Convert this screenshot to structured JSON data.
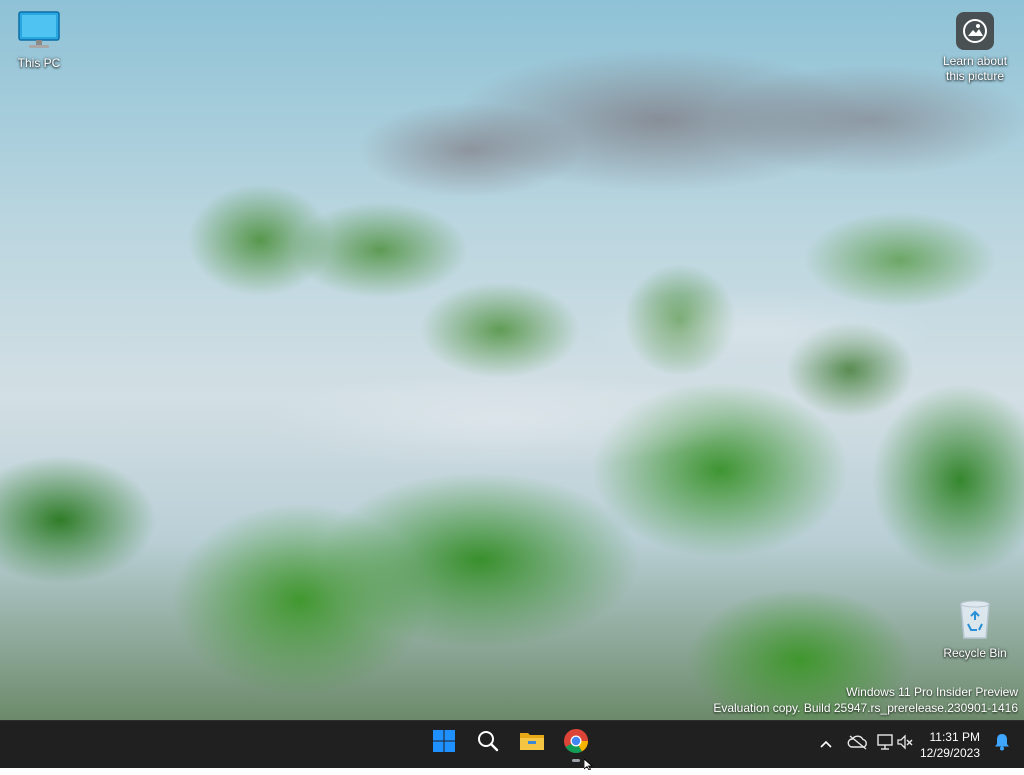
{
  "desktop": {
    "icons": {
      "this_pc": "This PC",
      "learn_line1": "Learn about",
      "learn_line2": "this picture",
      "recycle_bin": "Recycle Bin"
    },
    "watermark": {
      "line1": "Windows 11 Pro Insider Preview",
      "line2": "Evaluation copy. Build 25947.rs_prerelease.230901-1416"
    }
  },
  "taskbar": {
    "pinned": [
      "start-icon",
      "search-icon",
      "file-explorer-icon",
      "chrome-icon"
    ],
    "clock": {
      "time": "11:31 PM",
      "date": "12/29/2023"
    }
  },
  "colors": {
    "taskbar_bg": "#202020",
    "windows_blue": "#1e90ff",
    "folder_yellow": "#f4c542",
    "notification_blue": "#3ea6ff"
  }
}
